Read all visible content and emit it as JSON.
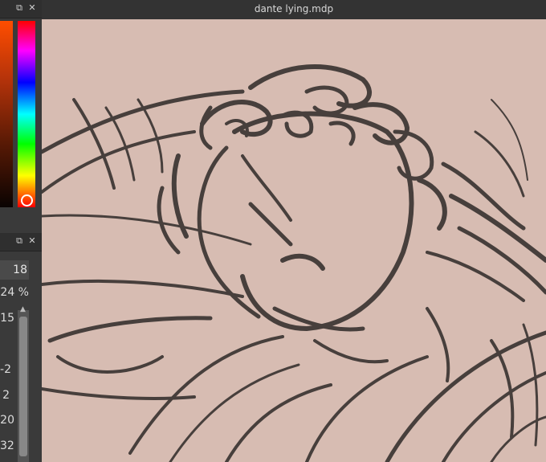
{
  "window": {
    "title": "dante lying.mdp"
  },
  "panel_color": {
    "name": "Color"
  },
  "panel_brush": {
    "size_value": "18",
    "opacity_value": "24 %",
    "list_values": [
      "15",
      "-2",
      "2",
      "20",
      "32"
    ]
  },
  "canvas": {
    "background_color": "#d7bcb2",
    "stroke_color": "#2f2a28"
  }
}
